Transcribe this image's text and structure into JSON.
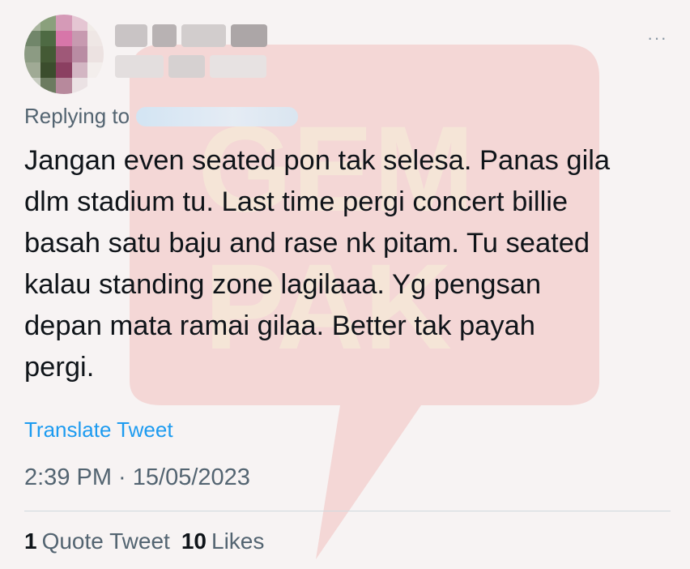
{
  "tweet": {
    "replying_to_label": "Replying to",
    "text": "Jangan even seated pon tak selesa. Panas gila\ndlm stadium tu. Last time pergi concert billie\nbasah satu baju and rase nk pitam. Tu seated\nkalau standing zone lagilaaa. Yg pengsan\ndepan mata ramai gilaa. Better tak payah\npergi.",
    "translate_label": "Translate Tweet",
    "timestamp": "2:39 PM · 15/05/2023",
    "more_icon": "more-horizontal-icon",
    "stats": {
      "quote_count": "1",
      "quote_label": "Quote Tweet",
      "like_count": "10",
      "like_label": "Likes"
    }
  },
  "watermark": {
    "text_line1": "GEM",
    "text_line2": "PAK",
    "color": "#e8b9b7"
  },
  "colors": {
    "background": "#f7f3f3",
    "link": "#1d9bf0",
    "secondary_text": "#536471",
    "primary_text": "#0f1419"
  }
}
